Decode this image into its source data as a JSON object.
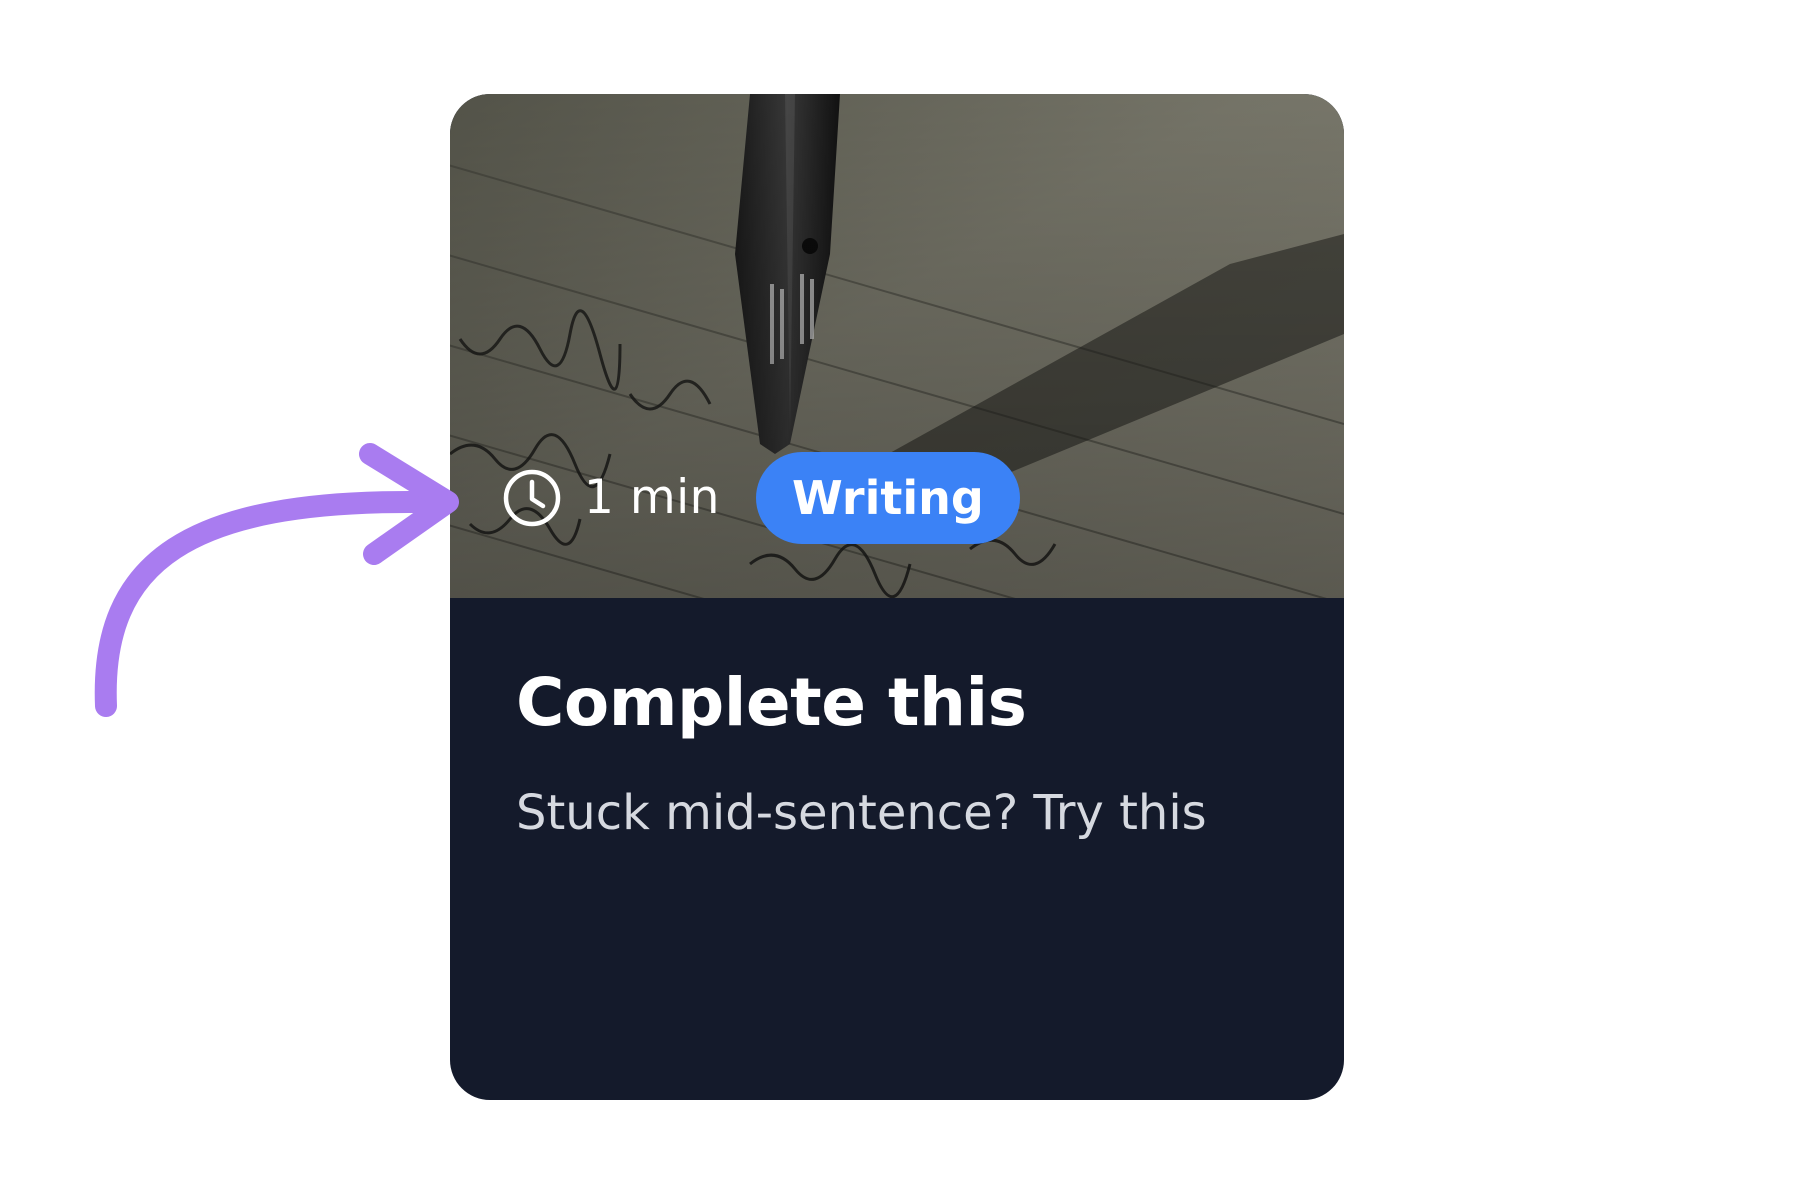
{
  "card": {
    "duration": "1 min",
    "category": "Writing",
    "title": "Complete this",
    "subtitle": "Stuck mid-sentence? Try this",
    "image_alt": "fountain-pen-writing-on-lined-paper"
  },
  "annotation": {
    "arrow_color": "#a97cf0",
    "icon": "curved-arrow-icon"
  },
  "colors": {
    "card_background": "#141a2b",
    "badge_background": "#3b82f6",
    "title_text": "#ffffff",
    "subtitle_text": "#d6d9e0"
  },
  "icons": {
    "clock": "clock-icon"
  }
}
